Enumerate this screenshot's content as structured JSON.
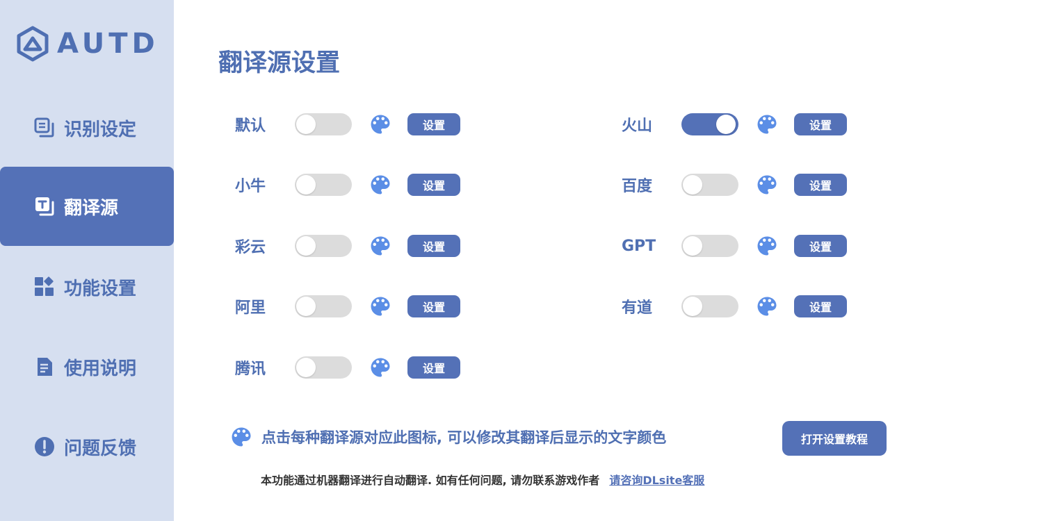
{
  "app": {
    "logo_text": "AUTD"
  },
  "sidebar": {
    "items": [
      {
        "label": "识别设定",
        "icon": "scan-copy-icon",
        "active": false
      },
      {
        "label": "翻译源",
        "icon": "translate-icon",
        "active": true
      },
      {
        "label": "功能设置",
        "icon": "widgets-icon",
        "active": false
      },
      {
        "label": "使用说明",
        "icon": "document-icon",
        "active": false
      },
      {
        "label": "问题反馈",
        "icon": "alert-icon",
        "active": false
      }
    ]
  },
  "main": {
    "title": "翻译源设置",
    "button_label": "设置",
    "sources": [
      {
        "name": "默认",
        "enabled": false
      },
      {
        "name": "火山",
        "enabled": true
      },
      {
        "name": "小牛",
        "enabled": false
      },
      {
        "name": "百度",
        "enabled": false
      },
      {
        "name": "彩云",
        "enabled": false
      },
      {
        "name": "GPT",
        "enabled": false
      },
      {
        "name": "阿里",
        "enabled": false
      },
      {
        "name": "有道",
        "enabled": false
      },
      {
        "name": "腾讯",
        "enabled": false
      }
    ],
    "hint": "点击每种翻译源对应此图标, 可以修改其翻译后显示的文字颜色",
    "tutorial_button": "打开设置教程",
    "footer_note": "本功能通过机器翻译进行自动翻译. 如有任何问题, 请勿联系游戏作者",
    "footer_link": "请咨询DLsite客服"
  },
  "colors": {
    "accent": "#5471b7",
    "sidebar_bg": "#d6dff0",
    "palette_icon": "#5b8ee6",
    "toggle_off": "#dcdcdc"
  }
}
